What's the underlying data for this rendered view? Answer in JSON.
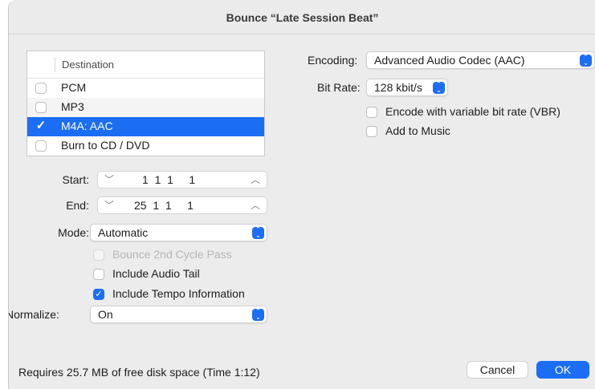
{
  "dialog": {
    "title": "Bounce “Late Session Beat”"
  },
  "destination": {
    "header": "Destination",
    "items": [
      {
        "label": "PCM",
        "checked": false
      },
      {
        "label": "MP3",
        "checked": false
      },
      {
        "label": "M4A: AAC",
        "checked": true,
        "selected": true
      },
      {
        "label": "Burn to CD / DVD",
        "checked": false
      }
    ]
  },
  "start": {
    "label": "Start:",
    "value": "1  1  1     1"
  },
  "end": {
    "label": "End:",
    "value": "25  1  1     1"
  },
  "mode": {
    "label": "Mode:",
    "value": "Automatic"
  },
  "options": {
    "bounce_2nd_cycle": {
      "label": "Bounce 2nd Cycle Pass",
      "checked": false,
      "disabled": true
    },
    "include_audio_tail": {
      "label": "Include Audio Tail",
      "checked": false
    },
    "include_tempo": {
      "label": "Include Tempo Information",
      "checked": true
    }
  },
  "normalize": {
    "label": "Normalize:",
    "value": "On"
  },
  "encoding": {
    "label": "Encoding:",
    "value": "Advanced Audio Codec (AAC)"
  },
  "bitrate": {
    "label": "Bit Rate:",
    "value": "128 kbit/s"
  },
  "vbr": {
    "label": "Encode with variable bit rate (VBR)",
    "checked": false
  },
  "add_to_music": {
    "label": "Add to Music",
    "checked": false
  },
  "status": {
    "text": "Requires 25.7 MB of free disk space  (Time 1:12)"
  },
  "buttons": {
    "cancel": "Cancel",
    "ok": "OK"
  },
  "colors": {
    "accent": "#1b6ef3",
    "background": "#ececec"
  }
}
